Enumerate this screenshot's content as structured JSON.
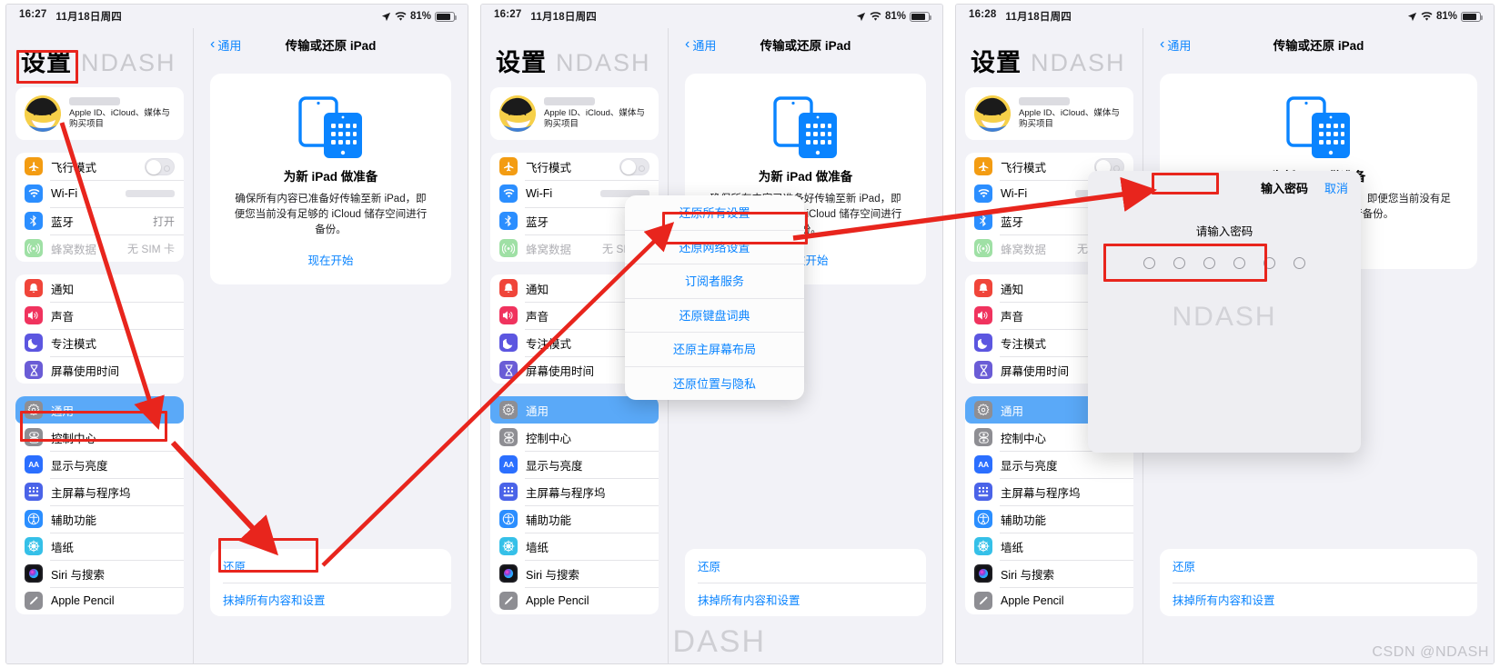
{
  "watermark": {
    "inline": "NDASH",
    "corner": "CSDN @NDASH"
  },
  "status": {
    "time_1": "16:27",
    "time_2": "16:27",
    "time_3": "16:28",
    "date": "11月18日周四",
    "battery": "81%"
  },
  "sidebar": {
    "title": "设置",
    "account": {
      "subtitle": "Apple ID、iCloud、媒体与购买项目"
    },
    "groups": [
      [
        {
          "label": "飞行模式",
          "value": "",
          "icon": "airplane-icon",
          "color": "#f39c12",
          "control": "toggle"
        },
        {
          "label": "Wi-Fi",
          "value": "",
          "icon": "wifi-icon",
          "color": "#2b8eff",
          "control": "blur"
        },
        {
          "label": "蓝牙",
          "value": "打开",
          "icon": "bluetooth-icon",
          "color": "#2b8eff",
          "control": "text"
        },
        {
          "label": "蜂窝数据",
          "value": "无 SIM 卡",
          "icon": "cellular-icon",
          "color": "#9fe0a5",
          "control": "text",
          "dim": true
        }
      ],
      [
        {
          "label": "通知",
          "value": "",
          "icon": "bell-icon",
          "color": "#f0453a"
        },
        {
          "label": "声音",
          "value": "",
          "icon": "speaker-icon",
          "color": "#f0335e"
        },
        {
          "label": "专注模式",
          "value": "",
          "icon": "moon-icon",
          "color": "#5c56e0"
        },
        {
          "label": "屏幕使用时间",
          "value": "",
          "icon": "hourglass-icon",
          "color": "#6a5cd6"
        }
      ],
      [
        {
          "label": "通用",
          "value": "",
          "icon": "gear-icon",
          "color": "#8e8e93",
          "selected": true
        },
        {
          "label": "控制中心",
          "value": "",
          "icon": "sliders-icon",
          "color": "#8e8e93"
        },
        {
          "label": "显示与亮度",
          "value": "",
          "icon": "aa-icon",
          "color": "#2b6fff"
        },
        {
          "label": "主屏幕与程序坞",
          "value": "",
          "icon": "grid-icon",
          "color": "#4a63e8"
        },
        {
          "label": "辅助功能",
          "value": "",
          "icon": "accessibility-icon",
          "color": "#2b8eff"
        },
        {
          "label": "墙纸",
          "value": "",
          "icon": "wallpaper-icon",
          "color": "#35c0e8"
        },
        {
          "label": "Siri 与搜索",
          "value": "",
          "icon": "siri-icon",
          "color": "#1d1d22"
        },
        {
          "label": "Apple Pencil",
          "value": "",
          "icon": "pencil-icon",
          "color": "#8e8e93"
        }
      ]
    ]
  },
  "detail": {
    "back": "通用",
    "title": "传输或还原 iPad",
    "card": {
      "heading": "为新 iPad 做准备",
      "body": "确保所有内容已准备好传输至新 iPad，即便您当前没有足够的 iCloud 储存空间进行备份。",
      "cta": "现在开始"
    },
    "actions": [
      {
        "label": "还原"
      },
      {
        "label": "抹掉所有内容和设置"
      }
    ]
  },
  "popup_menu": {
    "items": [
      {
        "label": "还原所有设置",
        "highlighted": true
      },
      {
        "label": "还原网络设置"
      },
      {
        "label": "订阅者服务"
      },
      {
        "label": "还原键盘词典"
      },
      {
        "label": "还原主屏幕布局"
      },
      {
        "label": "还原位置与隐私"
      }
    ]
  },
  "password_dialog": {
    "title": "输入密码",
    "cancel": "取消",
    "prompt": "请输入密码",
    "dot_count": 6
  }
}
